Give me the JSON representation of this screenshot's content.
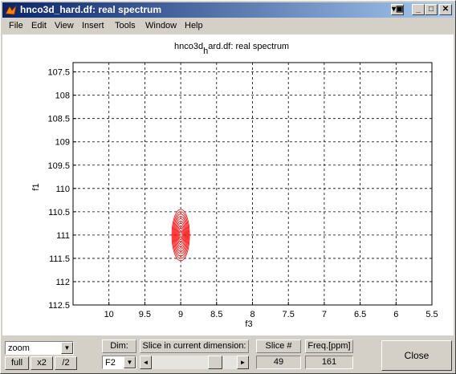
{
  "window": {
    "title": "hnco3d_hard.df: real spectrum",
    "buttons": {
      "extra": "▾▣",
      "minimize": "_",
      "maximize": "□",
      "close": "✕"
    }
  },
  "menu": [
    "File",
    "Edit",
    "View",
    "Insert",
    "Tools",
    "Window",
    "Help"
  ],
  "plot": {
    "title_main": "hnco3d",
    "title_sub": "h",
    "title_rest": "ard.df: real spectrum",
    "xlabel": "f3",
    "ylabel": "f1",
    "x_ticks": [
      "10",
      "9.5",
      "9",
      "8.5",
      "8",
      "7.5",
      "7",
      "6.5",
      "6",
      "5.5"
    ],
    "y_ticks": [
      "107.5",
      "108",
      "108.5",
      "109",
      "109.5",
      "110",
      "110.5",
      "111",
      "111.5",
      "112",
      "112.5"
    ],
    "contour_color": "#ff0000"
  },
  "chart_data": {
    "type": "contour",
    "title": "hnco3d_hard.df: real spectrum",
    "xlabel": "f3",
    "ylabel": "f1",
    "xlim": [
      10.5,
      5.5
    ],
    "ylim": [
      112.5,
      107.3
    ],
    "x_reversed": true,
    "y_reversed": true,
    "grid": true,
    "peaks": [
      {
        "x": 9.0,
        "y": 111.0,
        "color": "#ff0000",
        "levels": 10
      }
    ]
  },
  "controls": {
    "zoom_select": "zoom",
    "full_label": "full",
    "x2_label": "x2",
    "div2_label": "/2",
    "dim_label": "Dim:",
    "dim_value": "F2",
    "slice_label": "Slice in current dimension:",
    "slice_num_label": "Slice #",
    "slice_num_value": "49",
    "freq_label": "Freq.[ppm]",
    "freq_value": "161",
    "close_label": "Close",
    "scroll_left": "◄",
    "scroll_right": "►"
  }
}
